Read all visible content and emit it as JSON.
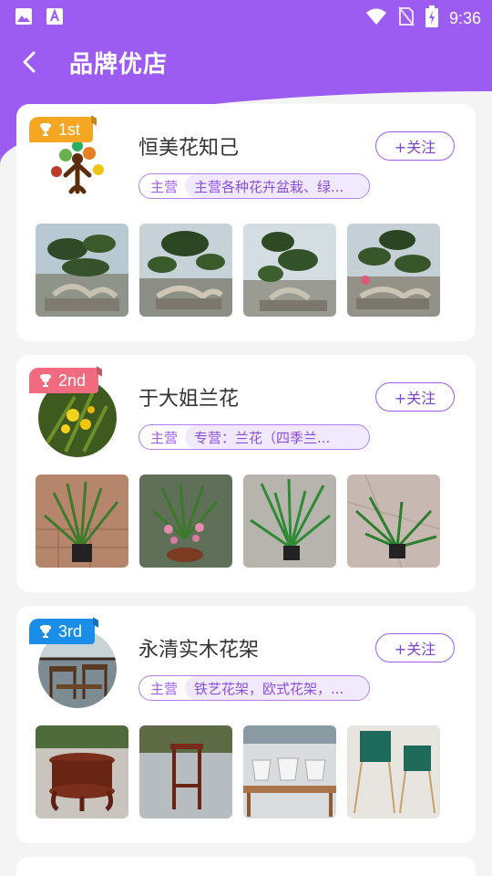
{
  "status_bar": {
    "time": "9:36",
    "left_icons": [
      "image-icon",
      "a-app-icon"
    ],
    "right_icons": [
      "wifi-icon",
      "no-sim-icon",
      "battery-charging-icon"
    ]
  },
  "header": {
    "title": "品牌优店",
    "background_color": "#9c5cf2"
  },
  "shops": [
    {
      "rank": "1st",
      "name": "恒美花知己",
      "follow_label": "+关注",
      "main_label": "主营",
      "main_text": "主营各种花卉盆栽、绿...",
      "avatar": "logo-tree-figure",
      "thumbnails": [
        "bonsai-pine-1",
        "bonsai-pine-2",
        "bonsai-pine-3",
        "bonsai-pine-4"
      ]
    },
    {
      "rank": "2nd",
      "name": "于大姐兰花",
      "follow_label": "+关注",
      "main_label": "主营",
      "main_text": "专营：兰花（四季兰...",
      "avatar": "yellow-orchid-photo",
      "thumbnails": [
        "orchid-pot-1",
        "orchid-pot-2",
        "orchid-pot-3",
        "orchid-pot-4"
      ]
    },
    {
      "rank": "3rd",
      "name": "永清实木花架",
      "follow_label": "+关注",
      "main_label": "主营",
      "main_text": "铁艺花架，欧式花架，...",
      "avatar": "wooden-stand-photo",
      "thumbnails": [
        "round-wood-stand",
        "tall-wood-stand",
        "white-planters",
        "green-metal-planters"
      ]
    }
  ],
  "colors": {
    "accent": "#9c5cf2",
    "rank_gold": "#f5a623",
    "rank_pink": "#f06b7f",
    "rank_blue": "#1a8de8"
  }
}
